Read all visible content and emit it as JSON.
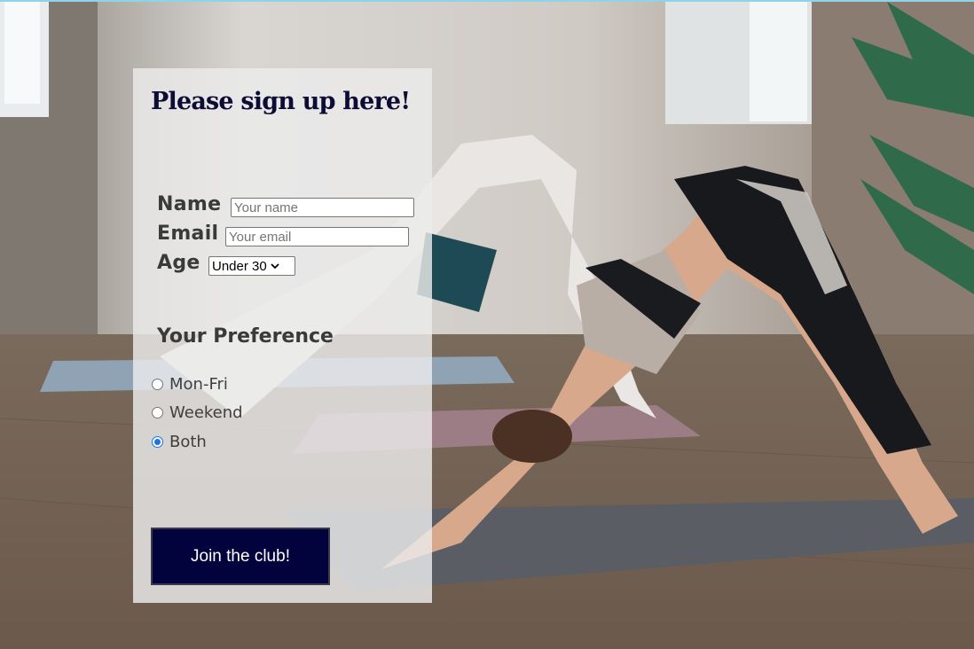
{
  "form": {
    "title": "Please sign up here!",
    "name_label": "Name",
    "name_placeholder": "Your name",
    "email_label": "Email",
    "email_placeholder": "Your email",
    "age_label": "Age",
    "age_selected": "Under 30",
    "preference_heading": "Your Preference",
    "preferences": [
      {
        "label": "Mon-Fri",
        "checked": false
      },
      {
        "label": "Weekend",
        "checked": false
      },
      {
        "label": "Both",
        "checked": true
      }
    ],
    "submit_label": "Join the club!"
  },
  "colors": {
    "title": "#0c0c36",
    "button_bg": "#02023d",
    "panel_bg": "#ececec",
    "radio_accent": "#1a73e8"
  },
  "icons": {
    "age_dropdown": "chevron-down-icon"
  }
}
